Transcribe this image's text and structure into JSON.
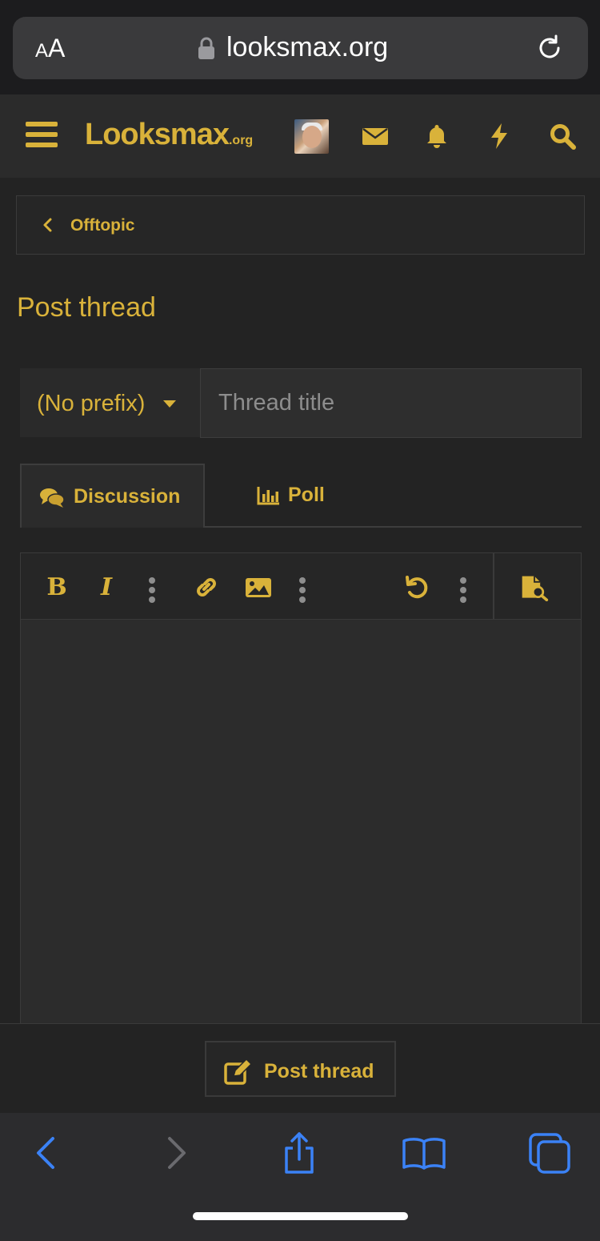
{
  "browser": {
    "text_size_label": "AA",
    "url": "looksmax.org",
    "lock_icon": "lock-icon",
    "reload_icon": "reload-icon"
  },
  "header": {
    "logo_main": "Looksmax",
    "logo_suffix": ".org",
    "menu_icon": "hamburger-menu-icon",
    "icons": [
      "avatar",
      "envelope-icon",
      "bell-icon",
      "bolt-icon",
      "search-icon"
    ],
    "accent_color": "#d9b23a"
  },
  "breadcrumb": {
    "label": "Offtopic"
  },
  "page": {
    "title": "Post thread"
  },
  "form": {
    "prefix_value": "(No prefix)",
    "title_placeholder": "Thread title",
    "tabs": [
      {
        "label": "Discussion",
        "icon": "comments-icon",
        "active": true
      },
      {
        "label": "Poll",
        "icon": "bar-chart-icon",
        "active": false
      }
    ],
    "toolbar": [
      "bold-icon",
      "italic-icon",
      "more-options-icon",
      "link-icon",
      "image-icon",
      "more-options-icon",
      "undo-icon",
      "more-options-icon",
      "preview-icon"
    ]
  },
  "footer": {
    "submit_label": "Post thread"
  },
  "safari_bottom": {
    "icons": [
      "back-icon",
      "forward-icon",
      "share-icon",
      "bookmarks-icon",
      "tabs-icon"
    ]
  }
}
